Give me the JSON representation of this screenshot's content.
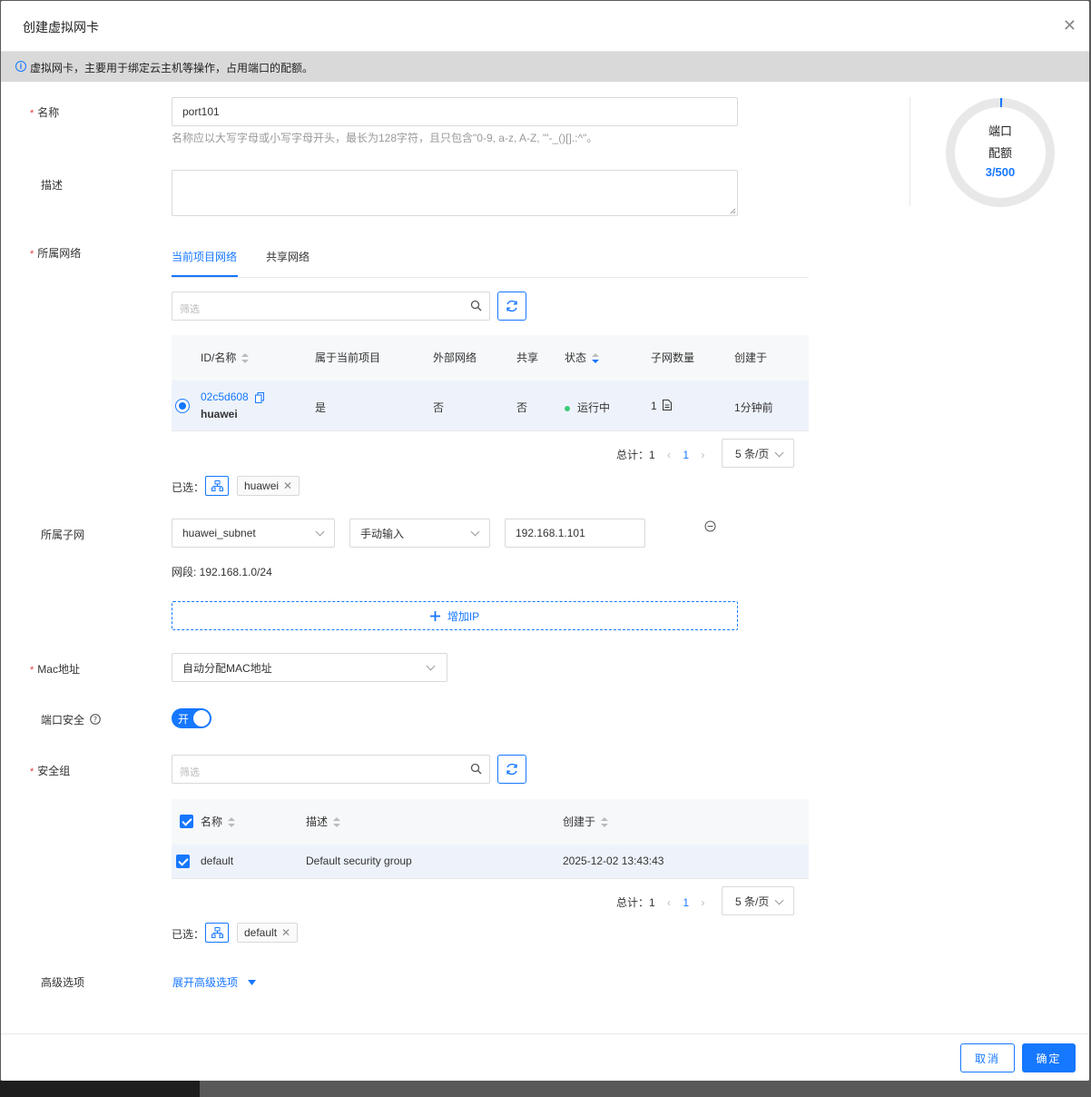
{
  "modal": {
    "title": "创建虚拟网卡",
    "info": "虚拟网卡，主要用于绑定云主机等操作，占用端口的配额。"
  },
  "form": {
    "name": {
      "label": "名称",
      "value": "port101",
      "hint": "名称应以大写字母或小写字母开头，最长为128字符，且只包含\"0-9, a-z, A-Z, \"'-_()[].:^\"。"
    },
    "description": {
      "label": "描述",
      "value": ""
    },
    "network": {
      "label": "所属网络",
      "tabs": [
        "当前项目网络",
        "共享网络"
      ],
      "filter_placeholder": "筛选",
      "columns": [
        "ID/名称",
        "属于当前项目",
        "外部网络",
        "共享",
        "状态",
        "子网数量",
        "创建于"
      ],
      "rows": [
        {
          "id": "02c5d608",
          "name": "huawei",
          "current_project": "是",
          "external": "否",
          "shared": "否",
          "status": "运行中",
          "subnets": "1",
          "created": "1分钟前"
        }
      ],
      "total_label": "总计：",
      "total": "1",
      "page": "1",
      "page_size": "5 条/页",
      "selected_label": "已选：",
      "selected_tag": "huawei"
    },
    "subnet": {
      "label": "所属子网",
      "subnet_value": "huawei_subnet",
      "ip_mode": "手动输入",
      "ip_value": "192.168.1.101",
      "cidr_text": "网段: 192.168.1.0/24",
      "add_ip_label": "增加IP"
    },
    "mac": {
      "label": "Mac地址",
      "value": "自动分配MAC地址"
    },
    "port_security": {
      "label": "端口安全",
      "toggle_text": "开",
      "enabled": true
    },
    "security_group": {
      "label": "安全组",
      "filter_placeholder": "筛选",
      "columns": [
        "名称",
        "描述",
        "创建于"
      ],
      "rows": [
        {
          "name": "default",
          "description": "Default security group",
          "created": "2025-12-02 13:43:43"
        }
      ],
      "total_label": "总计：",
      "total": "1",
      "page": "1",
      "page_size": "5 条/页",
      "selected_label": "已选：",
      "selected_tag": "default"
    },
    "advanced": {
      "label": "高级选项",
      "link": "展开高级选项"
    }
  },
  "quota": {
    "line1": "端口",
    "line2": "配额",
    "value": "3/500",
    "used": 3,
    "total": 500
  },
  "footer": {
    "cancel": "取消",
    "ok": "确定"
  },
  "colors": {
    "primary": "#1677ff",
    "required": "#e3393c",
    "status_running": "#3dcc78"
  }
}
